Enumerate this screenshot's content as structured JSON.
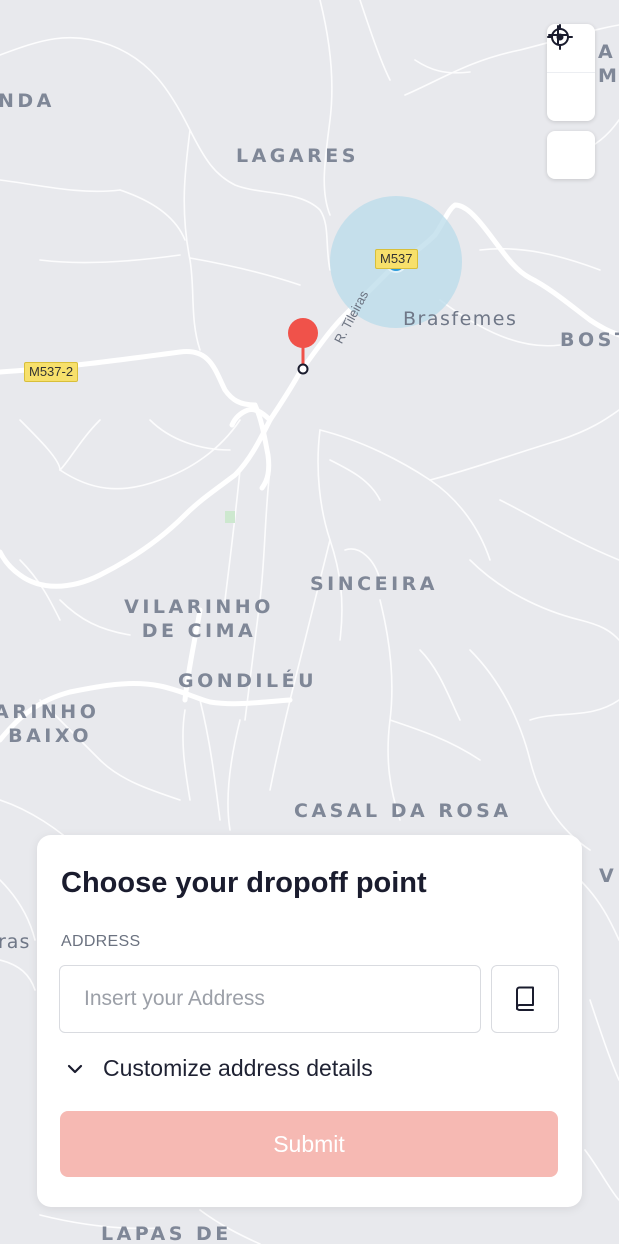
{
  "map": {
    "places": [
      {
        "id": "nda",
        "label": "NDA"
      },
      {
        "id": "lagares",
        "label": "LAGARES"
      },
      {
        "id": "brasfemes",
        "label": "Brasfemes"
      },
      {
        "id": "bost",
        "label": "BOST"
      },
      {
        "id": "am",
        "label": "A\nMA"
      },
      {
        "id": "sinceira",
        "label": "SINCEIRA"
      },
      {
        "id": "vilarinho-de-cima",
        "label": "VILARINHO\nDE CIMA"
      },
      {
        "id": "gondileu",
        "label": "GONDILÉU"
      },
      {
        "id": "arinho-baixo",
        "label": "ARINHO\nBAIXO"
      },
      {
        "id": "casal-da-rosa",
        "label": "CASAL DA ROSA"
      },
      {
        "id": "v",
        "label": "V"
      },
      {
        "id": "ras",
        "label": "ras"
      },
      {
        "id": "lapas-de",
        "label": "LAPAS DE"
      }
    ],
    "road_shields": [
      {
        "id": "m537",
        "label": "M537"
      },
      {
        "id": "m537-2",
        "label": "M537-2"
      }
    ],
    "street_label": "R. Tileiras",
    "controls": {
      "zoom_in_icon": "plus-icon",
      "zoom_out_icon": "minus-icon",
      "locate_icon": "crosshair-icon"
    },
    "colors": {
      "background": "#e8e9ed",
      "road": "#ffffff",
      "pin": "#f0524a",
      "user_location": "#2d9cdb",
      "accuracy_circle": "#b9dbe9"
    }
  },
  "form": {
    "title": "Choose your dropoff point",
    "address_label": "ADDRESS",
    "address_value": "",
    "address_placeholder": "Insert your Address",
    "address_book_icon": "book-icon",
    "customize_icon": "chevron-down-icon",
    "customize_label": "Customize address details",
    "submit_label": "Submit",
    "submit_color": "#f6b9b3"
  }
}
